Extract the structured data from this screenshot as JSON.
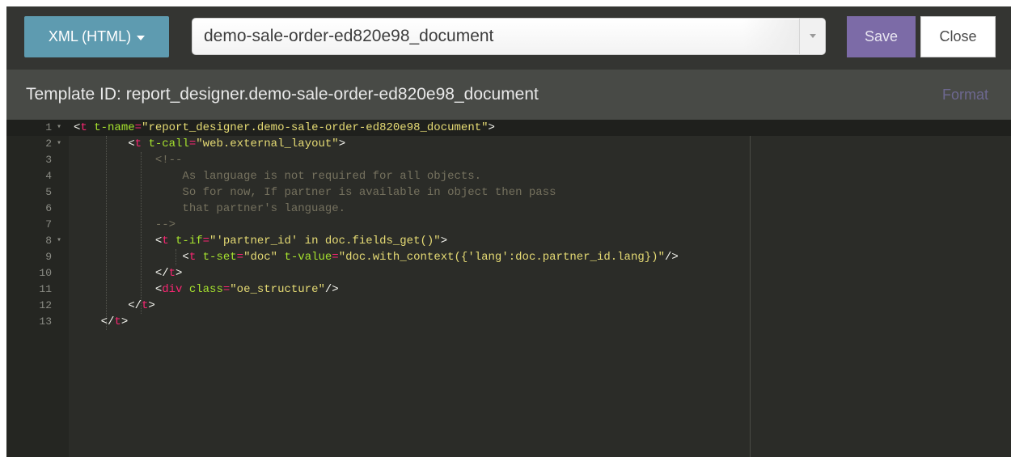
{
  "toolbar": {
    "mode_label": "XML (HTML)",
    "template_select_value": "demo-sale-order-ed820e98_document",
    "save_label": "Save",
    "close_label": "Close"
  },
  "header": {
    "template_id": "Template ID: report_designer.demo-sale-order-ed820e98_document",
    "format_label": "Format"
  },
  "colors": {
    "mode_button": "#5e9bb0",
    "save_button": "#7c6ba7",
    "editor_bg": "#2b2c28",
    "tag": "#f92672",
    "attribute": "#a6e22e",
    "string": "#e6db74",
    "comment": "#75715e"
  },
  "editor": {
    "line_numbers": [
      "1",
      "2",
      "3",
      "4",
      "5",
      "6",
      "7",
      "8",
      "9",
      "10",
      "11",
      "12",
      "13"
    ],
    "fold_markers": [
      "▾",
      "▾",
      "",
      "",
      "",
      "",
      "",
      "▾",
      "",
      "",
      "",
      "",
      ""
    ],
    "lines": [
      [
        {
          "t": "br",
          "v": "<"
        },
        {
          "t": "tag",
          "v": "t"
        },
        {
          "t": "br",
          "v": " "
        },
        {
          "t": "attr",
          "v": "t-name"
        },
        {
          "t": "eq",
          "v": "="
        },
        {
          "t": "str",
          "v": "\"report_designer.demo-sale-order-ed820e98_document\""
        },
        {
          "t": "br",
          "v": ">"
        }
      ],
      [
        {
          "t": "br",
          "v": "        <"
        },
        {
          "t": "tag",
          "v": "t"
        },
        {
          "t": "br",
          "v": " "
        },
        {
          "t": "attr",
          "v": "t-call"
        },
        {
          "t": "eq",
          "v": "="
        },
        {
          "t": "str",
          "v": "\"web.external_layout\""
        },
        {
          "t": "br",
          "v": ">"
        }
      ],
      [
        {
          "t": "com",
          "v": "            <!--"
        }
      ],
      [
        {
          "t": "com",
          "v": "                As language is not required for all objects."
        }
      ],
      [
        {
          "t": "com",
          "v": "                So for now, If partner is available in object then pass"
        }
      ],
      [
        {
          "t": "com",
          "v": "                that partner's language."
        }
      ],
      [
        {
          "t": "com",
          "v": "            -->"
        }
      ],
      [
        {
          "t": "br",
          "v": "            <"
        },
        {
          "t": "tag",
          "v": "t"
        },
        {
          "t": "br",
          "v": " "
        },
        {
          "t": "attr",
          "v": "t-if"
        },
        {
          "t": "eq",
          "v": "="
        },
        {
          "t": "str",
          "v": "\"'partner_id' in doc.fields_get()\""
        },
        {
          "t": "br",
          "v": ">"
        }
      ],
      [
        {
          "t": "br",
          "v": "                <"
        },
        {
          "t": "tag",
          "v": "t"
        },
        {
          "t": "br",
          "v": " "
        },
        {
          "t": "attr",
          "v": "t-set"
        },
        {
          "t": "eq",
          "v": "="
        },
        {
          "t": "str",
          "v": "\"doc\""
        },
        {
          "t": "br",
          "v": " "
        },
        {
          "t": "attr",
          "v": "t-value"
        },
        {
          "t": "eq",
          "v": "="
        },
        {
          "t": "str",
          "v": "\"doc.with_context({'lang':doc.partner_id.lang})\""
        },
        {
          "t": "br",
          "v": "/>"
        }
      ],
      [
        {
          "t": "br",
          "v": "            </"
        },
        {
          "t": "tag",
          "v": "t"
        },
        {
          "t": "br",
          "v": ">"
        }
      ],
      [
        {
          "t": "br",
          "v": "            <"
        },
        {
          "t": "tag",
          "v": "div"
        },
        {
          "t": "br",
          "v": " "
        },
        {
          "t": "attr",
          "v": "class"
        },
        {
          "t": "eq",
          "v": "="
        },
        {
          "t": "str",
          "v": "\"oe_structure\""
        },
        {
          "t": "br",
          "v": "/>"
        }
      ],
      [
        {
          "t": "br",
          "v": "        </"
        },
        {
          "t": "tag",
          "v": "t"
        },
        {
          "t": "br",
          "v": ">"
        }
      ],
      [
        {
          "t": "br",
          "v": "    </"
        },
        {
          "t": "tag",
          "v": "t"
        },
        {
          "t": "br",
          "v": ">"
        }
      ]
    ]
  }
}
